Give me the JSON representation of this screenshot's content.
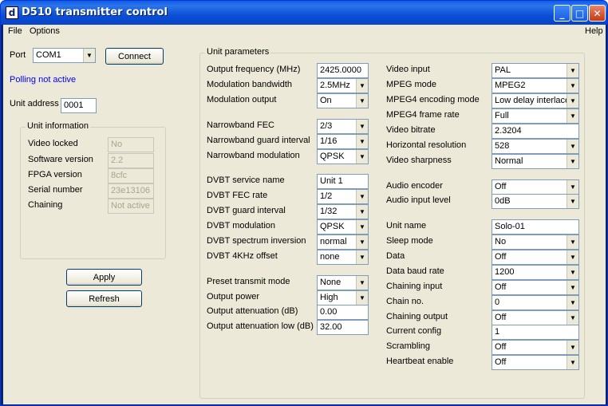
{
  "window": {
    "title": "D510 transmitter control",
    "app_icon_letter": "d"
  },
  "menu": {
    "file": "File",
    "options": "Options",
    "help": "Help"
  },
  "left": {
    "port_label": "Port",
    "port_value": "COM1",
    "connect_label": "Connect",
    "polling_status": "Polling not active",
    "unit_address_label": "Unit address",
    "unit_address_value": "0001",
    "unit_info": {
      "title": "Unit information",
      "rows": [
        {
          "label": "Video locked",
          "value": "No"
        },
        {
          "label": "Software version",
          "value": "2.2"
        },
        {
          "label": "FPGA version",
          "value": "8cfc"
        },
        {
          "label": "Serial number",
          "value": "23e13106"
        },
        {
          "label": "Chaining",
          "value": "Not active"
        }
      ]
    },
    "apply_label": "Apply",
    "refresh_label": "Refresh"
  },
  "params": {
    "title": "Unit parameters",
    "col1": [
      {
        "label": "Output frequency (MHz)",
        "value": "2425.0000",
        "kind": "text"
      },
      {
        "label": "Modulation bandwidth",
        "value": "2.5MHz",
        "kind": "dropdown"
      },
      {
        "label": "Modulation output",
        "value": "On",
        "kind": "dropdown"
      },
      {
        "label": "Narrowband FEC",
        "value": "2/3",
        "kind": "dropdown"
      },
      {
        "label": "Narrowband guard interval",
        "value": "1/16",
        "kind": "dropdown"
      },
      {
        "label": "Narrowband modulation",
        "value": "QPSK",
        "kind": "dropdown"
      },
      {
        "label": "DVBT service name",
        "value": "Unit 1",
        "kind": "text"
      },
      {
        "label": "DVBT FEC rate",
        "value": "1/2",
        "kind": "dropdown"
      },
      {
        "label": "DVBT guard interval",
        "value": "1/32",
        "kind": "dropdown"
      },
      {
        "label": "DVBT modulation",
        "value": "QPSK",
        "kind": "dropdown"
      },
      {
        "label": "DVBT spectrum inversion",
        "value": "normal",
        "kind": "dropdown"
      },
      {
        "label": "DVBT 4KHz offset",
        "value": "none",
        "kind": "dropdown"
      },
      {
        "label": "Preset transmit mode",
        "value": "None",
        "kind": "dropdown"
      },
      {
        "label": "Output power",
        "value": "High",
        "kind": "dropdown"
      },
      {
        "label": "Output attenuation (dB)",
        "value": "0.00",
        "kind": "text"
      },
      {
        "label": "Output attenuation low (dB)",
        "value": "32.00",
        "kind": "text"
      }
    ],
    "col2": [
      {
        "label": "Video input",
        "value": "PAL",
        "kind": "dropdown"
      },
      {
        "label": "MPEG mode",
        "value": "MPEG2",
        "kind": "dropdown"
      },
      {
        "label": "MPEG4 encoding mode",
        "value": "Low delay interlace",
        "kind": "dropdown"
      },
      {
        "label": "MPEG4 frame rate",
        "value": "Full",
        "kind": "dropdown"
      },
      {
        "label": "Video bitrate",
        "value": "2.3204",
        "kind": "text"
      },
      {
        "label": "Horizontal resolution",
        "value": "528",
        "kind": "dropdown"
      },
      {
        "label": "Video sharpness",
        "value": "Normal",
        "kind": "dropdown"
      },
      {
        "label": "Audio encoder",
        "value": "Off",
        "kind": "dropdown"
      },
      {
        "label": "Audio input level",
        "value": "0dB",
        "kind": "dropdown"
      },
      {
        "label": "Unit name",
        "value": "Solo-01",
        "kind": "text"
      },
      {
        "label": "Sleep mode",
        "value": "No",
        "kind": "dropdown"
      },
      {
        "label": "Data",
        "value": "Off",
        "kind": "dropdown"
      },
      {
        "label": "Data baud rate",
        "value": "1200",
        "kind": "dropdown"
      },
      {
        "label": "Chaining input",
        "value": "Off",
        "kind": "dropdown"
      },
      {
        "label": "Chain no.",
        "value": "0",
        "kind": "dropdown"
      },
      {
        "label": "Chaining output",
        "value": "Off",
        "kind": "dropdown"
      },
      {
        "label": "Current config",
        "value": "1",
        "kind": "text"
      },
      {
        "label": "Scrambling",
        "value": "Off",
        "kind": "dropdown"
      },
      {
        "label": "Heartbeat enable",
        "value": "Off",
        "kind": "dropdown"
      }
    ]
  }
}
